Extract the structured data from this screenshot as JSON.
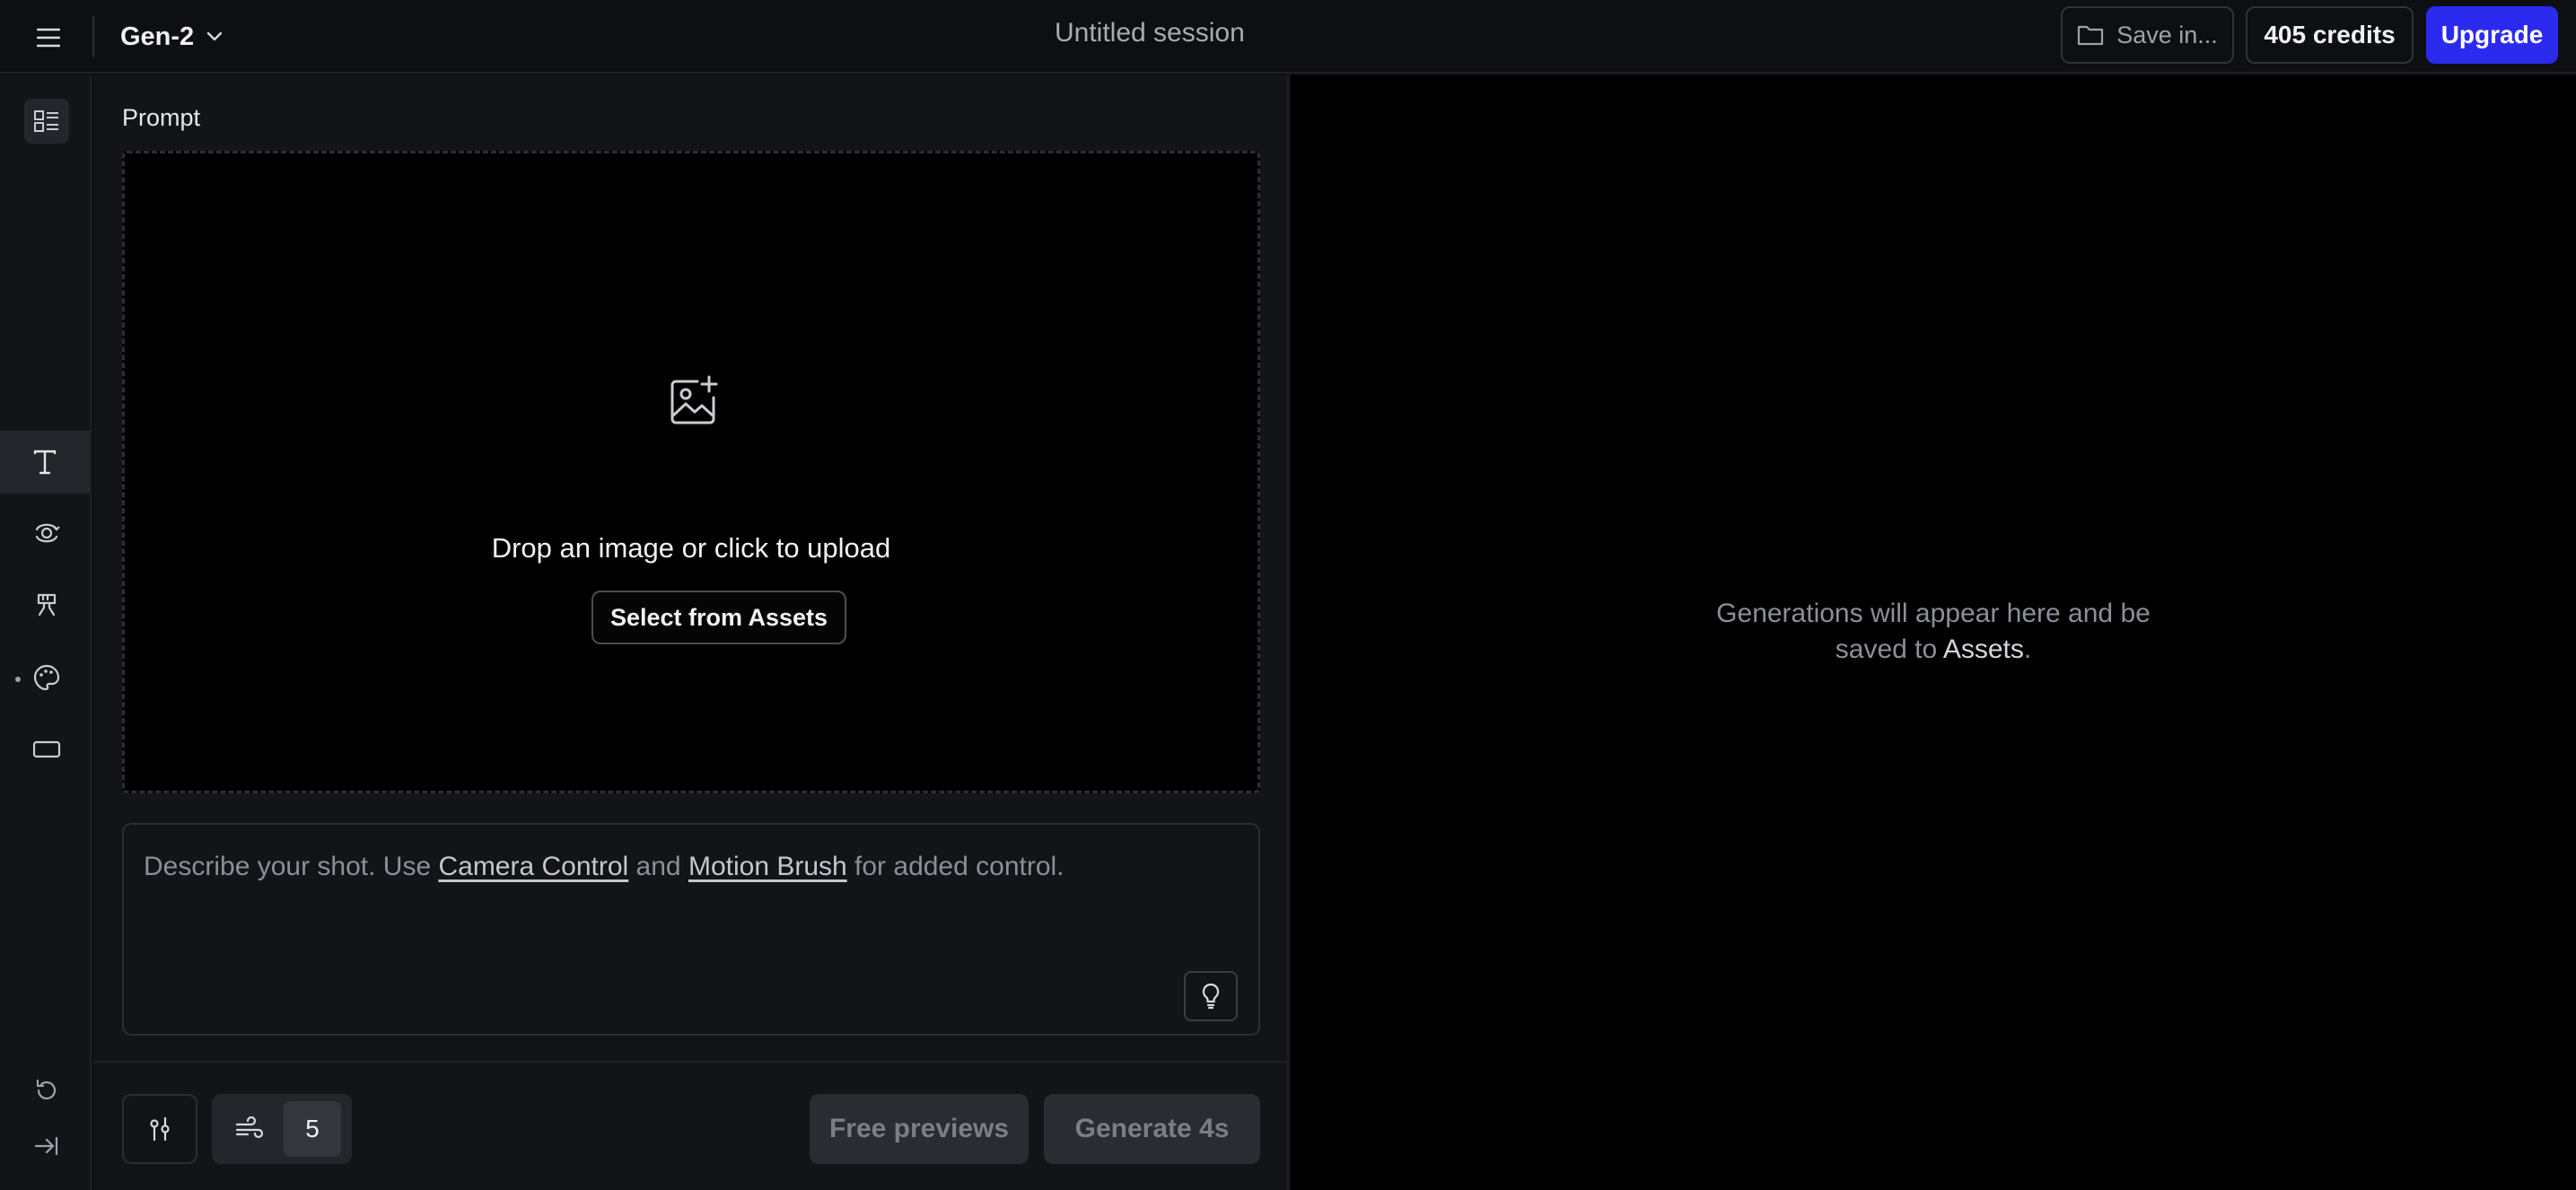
{
  "header": {
    "model_name": "Gen-2",
    "session_title": "Untitled session",
    "save_label": "Save in...",
    "credits_label": "405 credits",
    "upgrade_label": "Upgrade"
  },
  "prompt": {
    "label": "Prompt",
    "drop_text": "Drop an image or click to upload",
    "select_assets_label": "Select from Assets",
    "placeholder_pre": "Describe your shot. Use ",
    "camera_control_link": "Camera Control",
    "placeholder_mid": " and ",
    "motion_brush_link": "Motion Brush",
    "placeholder_post": " for added control."
  },
  "controls": {
    "motion_value": "5",
    "free_previews_label": "Free previews",
    "generate_label": "Generate 4s"
  },
  "output": {
    "message_pre": "Generations will appear here and be",
    "message_line2_pre": "saved to ",
    "message_assets": "Assets",
    "message_post": "."
  },
  "colors": {
    "accent": "#2b2bf0",
    "background": "#0e0f12",
    "panel": "#131418",
    "output_bg": "#000000"
  }
}
